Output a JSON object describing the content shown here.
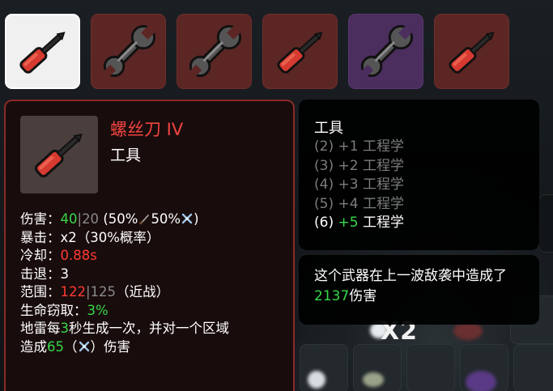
{
  "inventory": {
    "slots": [
      {
        "item": "screwdriver",
        "tier": "white"
      },
      {
        "item": "wrench",
        "tier": "red"
      },
      {
        "item": "wrench",
        "tier": "red"
      },
      {
        "item": "screwdriver",
        "tier": "red"
      },
      {
        "item": "wrench",
        "tier": "purple"
      },
      {
        "item": "screwdriver",
        "tier": "red"
      }
    ]
  },
  "item_card": {
    "name": "螺丝刀 IV",
    "class": "工具",
    "damage": {
      "label": "伤害：",
      "value": "40",
      "sep": "|",
      "base": "20",
      "scaling": "(50%",
      "scaling2": "50%",
      "close": ")"
    },
    "crit": {
      "label": "暴击：",
      "value": "x2（30%概率）"
    },
    "cooldown": {
      "label": "冷却：",
      "value": "0.88s"
    },
    "knockback": {
      "label": "击退：",
      "value": "3"
    },
    "range": {
      "label": "范围：",
      "value": "122",
      "sep": "|",
      "base": "125",
      "suffix": "（近战）"
    },
    "lifesteal": {
      "label": "生命窃取：",
      "value": "3%"
    },
    "special": {
      "prefix": "地雷每",
      "interval": "3",
      "mid": "秒生成一次，并对一个区域",
      "line2_prefix": "造成",
      "damage": "65",
      "open": "（",
      "close": "）",
      "suffix": "伤害"
    }
  },
  "set_bonus": {
    "title": "工具",
    "tiers": [
      {
        "count": "(2)",
        "bonus": "+1",
        "stat": "工程学",
        "active": false
      },
      {
        "count": "(3)",
        "bonus": "+2",
        "stat": "工程学",
        "active": false
      },
      {
        "count": "(4)",
        "bonus": "+3",
        "stat": "工程学",
        "active": false
      },
      {
        "count": "(5)",
        "bonus": "+4",
        "stat": "工程学",
        "active": false
      },
      {
        "count": "(6)",
        "bonus": "+5",
        "stat": "工程学",
        "active": true
      }
    ]
  },
  "damage_tooltip": {
    "text_before": "这个武器在上一波敌袭中造成了",
    "value": "2137",
    "text_after": "伤害"
  },
  "background": {
    "multiplier": "X2"
  },
  "colors": {
    "rarity_red": "#5c2624",
    "rarity_purple": "#4b2d5e",
    "rarity_white": "#f0f0f0",
    "title_red": "#f0443f",
    "positive_green": "#37d94a",
    "negative_red": "#ff3a33"
  }
}
